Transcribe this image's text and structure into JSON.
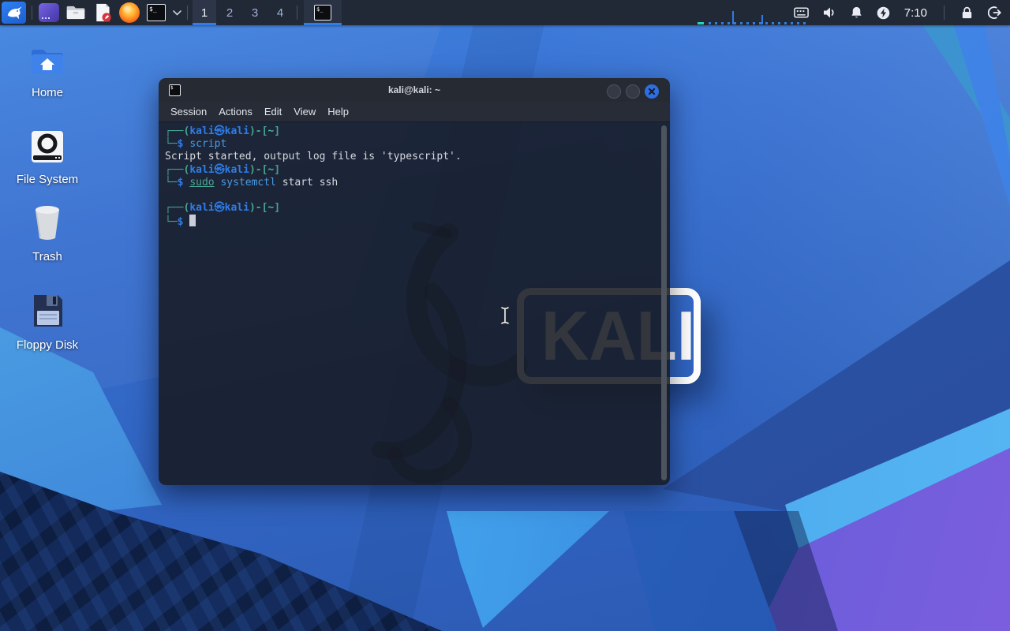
{
  "panel": {
    "workspaces": {
      "labels": [
        "1",
        "2",
        "3",
        "4"
      ],
      "active_index": 0
    },
    "clock": "7:10"
  },
  "desktop": {
    "icons": [
      {
        "label": "Home"
      },
      {
        "label": "File System"
      },
      {
        "label": "Trash"
      },
      {
        "label": "Floppy Disk"
      }
    ],
    "watermark_text": "KALI"
  },
  "terminal": {
    "title": "kali@kali: ~",
    "menu": [
      "Session",
      "Actions",
      "Edit",
      "View",
      "Help"
    ],
    "lines": [
      [
        {
          "t": "┌──(",
          "c": "frame"
        },
        {
          "t": "kali㉿kali",
          "c": "user"
        },
        {
          "t": ")-[",
          "c": "frame"
        },
        {
          "t": "~",
          "c": "tilde"
        },
        {
          "t": "]",
          "c": "frame"
        }
      ],
      [
        {
          "t": "└─",
          "c": "frame"
        },
        {
          "t": "$",
          "c": "user"
        },
        {
          "t": " ",
          "c": "plain"
        },
        {
          "t": "script",
          "c": "cmd"
        }
      ],
      [
        {
          "t": "Script started, output log file is 'typescript'.",
          "c": "plain"
        }
      ],
      [
        {
          "t": "┌──(",
          "c": "frame"
        },
        {
          "t": "kali㉿kali",
          "c": "user"
        },
        {
          "t": ")-[",
          "c": "frame"
        },
        {
          "t": "~",
          "c": "tilde"
        },
        {
          "t": "]",
          "c": "frame"
        }
      ],
      [
        {
          "t": "└─",
          "c": "frame"
        },
        {
          "t": "$",
          "c": "user"
        },
        {
          "t": " ",
          "c": "plain"
        },
        {
          "t": "sudo",
          "c": "sudo"
        },
        {
          "t": " ",
          "c": "plain"
        },
        {
          "t": "systemctl",
          "c": "cmd"
        },
        {
          "t": " start ssh",
          "c": "plain"
        }
      ],
      [],
      [
        {
          "t": "┌──(",
          "c": "frame"
        },
        {
          "t": "kali㉿kali",
          "c": "user"
        },
        {
          "t": ")-[",
          "c": "frame"
        },
        {
          "t": "~",
          "c": "tilde"
        },
        {
          "t": "]",
          "c": "frame"
        }
      ],
      [
        {
          "t": "└─",
          "c": "frame"
        },
        {
          "t": "$",
          "c": "user"
        },
        {
          "t": " ",
          "c": "plain"
        },
        {
          "t": "",
          "c": "cursor"
        }
      ]
    ]
  },
  "colors": {
    "accent_blue": "#2e7de9",
    "prompt_frame": "#47a48d",
    "prompt_user": "#2e7de9",
    "command_blue": "#4a9ae4",
    "sudo_teal": "#4aa893",
    "terminal_text": "#d6d9df",
    "close_button": "#2d6fe3",
    "panel_bg": "#212836"
  }
}
